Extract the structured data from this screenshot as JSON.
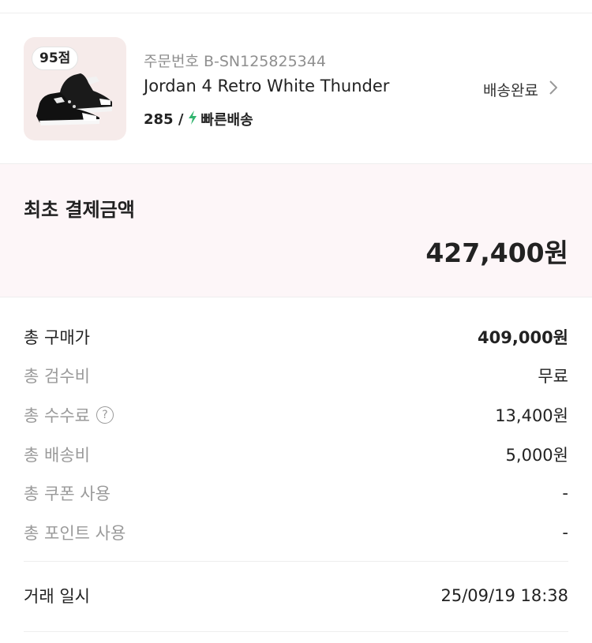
{
  "order": {
    "score_badge": "95점",
    "order_number": "주문번호 B-SN125825344",
    "product_name": "Jordan 4 Retro White Thunder",
    "size": "285 /",
    "delivery_type": "빠른배송",
    "status": "배송완료",
    "image": "jordan-4-shoe-image"
  },
  "payment": {
    "label": "최초 결제금액",
    "amount": "427,400원"
  },
  "breakdown": [
    {
      "label": "총 구매가",
      "value": "409,000원"
    },
    {
      "label": "총 검수비",
      "value": "무료"
    },
    {
      "label": "총 수수료",
      "value": "13,400원",
      "help": "?"
    },
    {
      "label": "총 배송비",
      "value": "5,000원"
    },
    {
      "label": "총 쿠폰 사용",
      "value": "-"
    },
    {
      "label": "총 포인트 사용",
      "value": "-"
    }
  ],
  "trade": {
    "label": "거래 일시",
    "value": "25/09/19 18:38"
  },
  "colors": {
    "thumb_bg": "#f6ebea",
    "total_bg": "#fdf6f8",
    "bolt": "#31b46e"
  }
}
